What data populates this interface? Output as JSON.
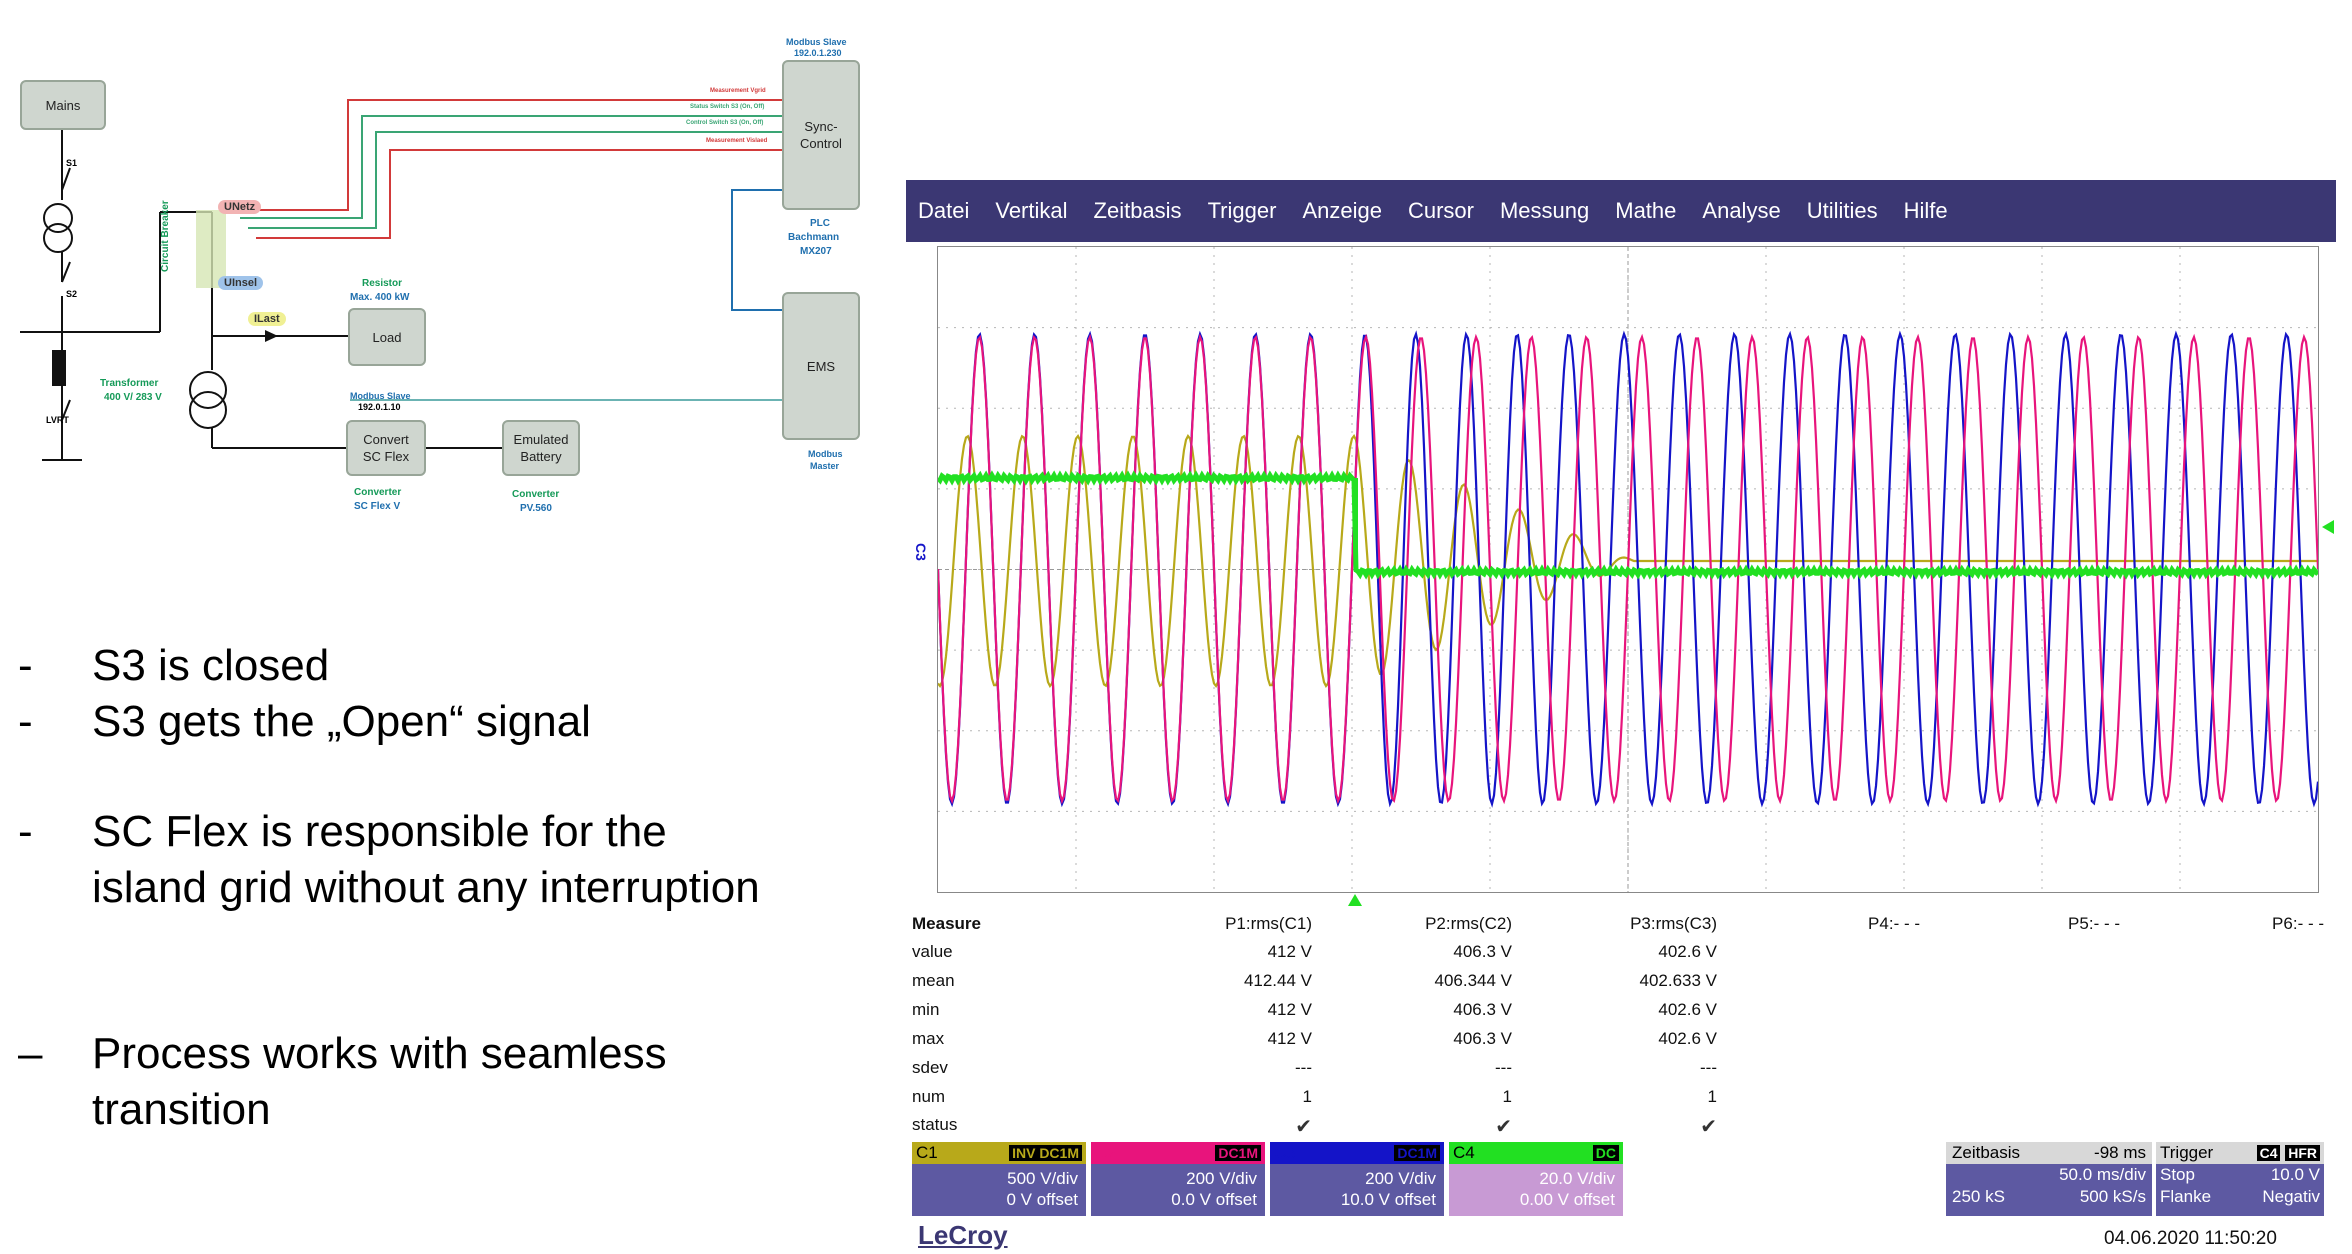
{
  "diagram": {
    "mains": "Mains",
    "s1": "S1",
    "s2": "S2",
    "lvrt": "LVRT",
    "transformer_label": "Transformer",
    "transformer_value": "400 V/ 283 V",
    "circuit_breaker": "Circuit Breaker",
    "u_netz": "UNetz",
    "u_insel": "UInsel",
    "i_last": "ILast",
    "resistor_label": "Resistor",
    "resistor_value": "Max. 400 kW",
    "load": "Load",
    "modbus_slave_1_label": "Modbus Slave",
    "modbus_slave_1_ip": "192.0.1.10",
    "convert_box": "Convert SC Flex",
    "converter_1_label": "Converter",
    "converter_1_value": "SC Flex V",
    "emulated_box": "Emulated Battery",
    "converter_2_label": "Converter",
    "converter_2_value": "PV.560",
    "modbus_slave_2_label": "Modbus Slave",
    "modbus_slave_2_ip": "192.0.1.230",
    "sync_control": "Sync-Control",
    "plc_label": "PLC",
    "plc_value": "Bachmann",
    "plc_model": "MX207",
    "ems": "EMS",
    "modbus_master_1": "Modbus",
    "modbus_master_2": "Master",
    "signals": [
      "Measurement Vgrid",
      "Status Switch S3 (On, Off)",
      "Control Switch S3 (On, Off)",
      "Measurement Vislaed"
    ]
  },
  "bullets": [
    {
      "marker": "-",
      "text": "S3 is closed"
    },
    {
      "marker": "-",
      "text": "S3 gets the „Open“ signal"
    },
    {
      "marker": "-",
      "text": "SC Flex is responsible for the island grid without any interruption"
    },
    {
      "marker": "–",
      "text": "Process works with seamless transition"
    }
  ],
  "scope": {
    "menu": [
      "Datei",
      "Vertikal",
      "Zeitbasis",
      "Trigger",
      "Anzeige",
      "Cursor",
      "Messung",
      "Mathe",
      "Analyse",
      "Utilities",
      "Hilfe"
    ],
    "measure": {
      "header": "Measure",
      "params": [
        "P1:rms(C1)",
        "P2:rms(C2)",
        "P3:rms(C3)",
        "P4:- - -",
        "P5:- - -",
        "P6:- - -"
      ],
      "rows": [
        {
          "label": "value",
          "values": [
            "412 V",
            "406.3 V",
            "402.6 V"
          ]
        },
        {
          "label": "mean",
          "values": [
            "412.44 V",
            "406.344 V",
            "402.633 V"
          ]
        },
        {
          "label": "min",
          "values": [
            "412 V",
            "406.3 V",
            "402.6 V"
          ]
        },
        {
          "label": "max",
          "values": [
            "412 V",
            "406.3 V",
            "402.6 V"
          ]
        },
        {
          "label": "sdev",
          "values": [
            "---",
            "---",
            "---"
          ]
        },
        {
          "label": "num",
          "values": [
            "1",
            "1",
            "1"
          ]
        },
        {
          "label": "status",
          "values": [
            "✔",
            "✔",
            "✔"
          ]
        }
      ]
    },
    "channels": [
      {
        "name": "C1",
        "badge": "INV DC1M",
        "scale": "500 V/div",
        "offset": "0 V offset",
        "color": "#b8a91a"
      },
      {
        "name": "C2",
        "badge": "DC1M",
        "scale": "200 V/div",
        "offset": "0.0 V offset",
        "color": "#e8147c"
      },
      {
        "name": "C3",
        "badge": "DC1M",
        "scale": "200 V/div",
        "offset": "10.0 V offset",
        "color": "#1414c8"
      },
      {
        "name": "C4",
        "badge": "DC",
        "scale": "20.0 V/div",
        "offset": "0.00 V offset",
        "color": "#22e022"
      }
    ],
    "zeitbasis": {
      "label": "Zeitbasis",
      "delay": "-98 ms",
      "rate": "50.0 ms/div",
      "samples": "250 kS",
      "sample_rate": "500 kS/s"
    },
    "trigger": {
      "label": "Trigger",
      "badge1": "C4",
      "badge2": "HFR",
      "mode": "Stop",
      "level": "10.0 V",
      "slope_label": "Flanke",
      "slope": "Negativ"
    },
    "brand": "LeCroy",
    "timestamp": "04.06.2020 11:50:20",
    "channel_marker": "C3"
  }
}
